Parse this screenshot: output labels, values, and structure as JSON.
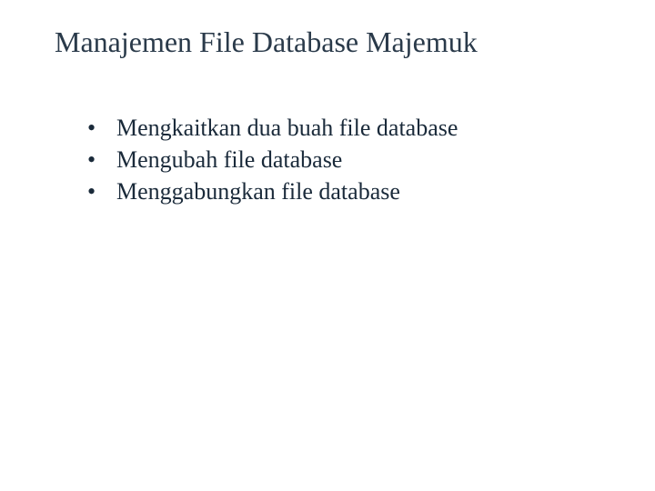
{
  "slide": {
    "title": "Manajemen File Database Majemuk",
    "bullets": [
      "Mengkaitkan dua buah file database",
      "Mengubah file database",
      "Menggabungkan file database"
    ]
  }
}
